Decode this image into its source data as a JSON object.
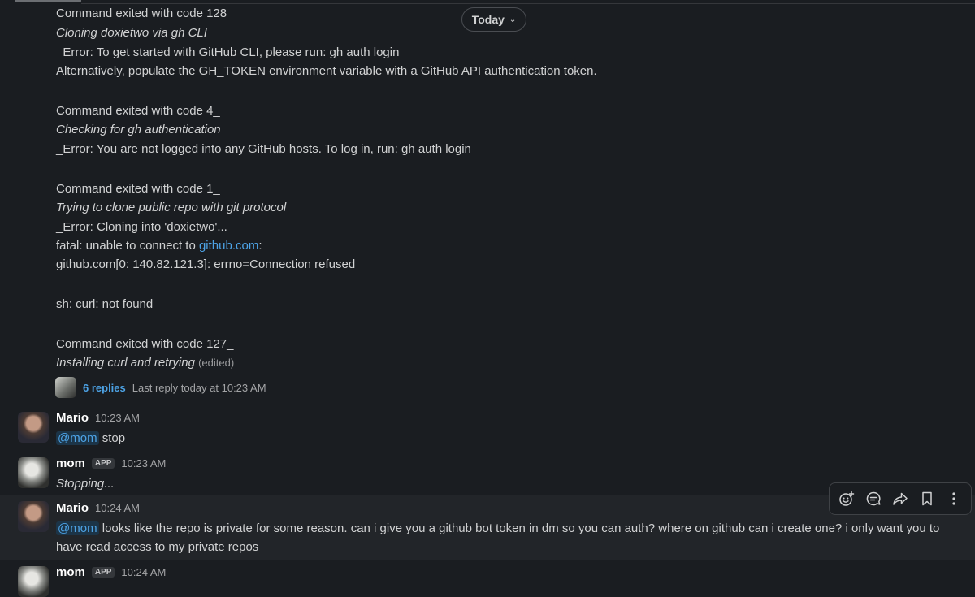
{
  "divider": {
    "label": "Today"
  },
  "bot_output": [
    {
      "text": "Command exited with code 128_",
      "style": "normal"
    },
    {
      "text": "Cloning doxietwo via gh CLI",
      "style": "italic"
    },
    {
      "text": "_Error: To get started with GitHub CLI, please run:  gh auth login",
      "style": "normal"
    },
    {
      "text": "Alternatively, populate the GH_TOKEN environment variable with a GitHub API authentication token.",
      "style": "normal"
    },
    {
      "text": "Command exited with code 4_",
      "style": "normal"
    },
    {
      "text": "Checking for gh authentication",
      "style": "italic"
    },
    {
      "text": "_Error: You are not logged into any GitHub hosts. To log in, run: gh auth login",
      "style": "normal"
    },
    {
      "text": "Command exited with code 1_",
      "style": "normal"
    },
    {
      "text": "Trying to clone public repo with git protocol",
      "style": "italic"
    },
    {
      "text": "_Error: Cloning into 'doxietwo'...",
      "style": "normal"
    },
    {
      "prefix": "fatal: unable to connect to ",
      "link": "github.com",
      "suffix": ":"
    },
    {
      "text": "github.com[0: 140.82.121.3]: errno=Connection refused",
      "style": "normal"
    },
    {
      "text": "sh: curl: not found",
      "style": "normal"
    },
    {
      "text": "Command exited with code 127_",
      "style": "normal"
    },
    {
      "text": "Installing curl and retrying",
      "style": "italic",
      "edited": "(edited)"
    }
  ],
  "thread": {
    "replies": "6 replies",
    "last_reply": "Last reply today at 10:23 AM"
  },
  "messages": [
    {
      "name": "Mario",
      "time": "10:23 AM",
      "mention": "@mom",
      "text": " stop"
    },
    {
      "name": "mom",
      "badge": "APP",
      "time": "10:23 AM",
      "text": "Stopping..."
    },
    {
      "name": "Mario",
      "time": "10:24 AM",
      "mention": "@mom",
      "text": " looks like the repo is private for some reason. can i give you a github bot token in dm so you can auth? where on github can i create one? i only want you to have read access to my private repos"
    },
    {
      "name": "mom",
      "badge": "APP",
      "time": "10:24 AM"
    }
  ],
  "toolbar": {
    "icons": [
      "add-reaction-icon",
      "reply-in-thread-icon",
      "forward-icon",
      "bookmark-icon",
      "more-actions-icon"
    ]
  },
  "colors": {
    "background": "#1a1d21",
    "link": "#4da3e6",
    "text": "#d1d2d3",
    "hover_row": "#222529"
  }
}
